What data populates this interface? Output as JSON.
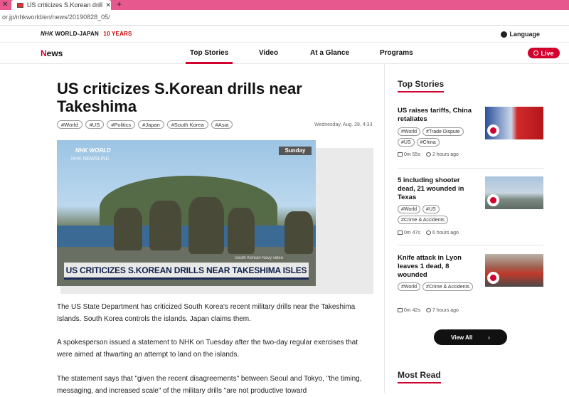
{
  "browser": {
    "tab_title": "US criticizes S.Korean drills nea",
    "url": "or.jp/nhkworld/en/news/20190828_05/"
  },
  "header": {
    "brand_nhk": "NHK",
    "brand_rest": "WORLD-JAPAN",
    "brand_years": "10 YEARS",
    "language": "Language",
    "news_logo_n": "N",
    "news_logo_rest": "ews",
    "nav": [
      "Top Stories",
      "Video",
      "At a Glance",
      "Programs"
    ],
    "live": "Live"
  },
  "article": {
    "headline": "US criticizes S.Korean drills near Takeshima",
    "tags": [
      "#World",
      "#US",
      "#Politics",
      "#Japan",
      "#South Korea",
      "#Asia"
    ],
    "date": "Wednesday, Aug. 28, 4:33",
    "video": {
      "logo": "NHK WORLD",
      "sub": "NHK NEWSLINE",
      "day": "Sunday",
      "caption": "US CRITICIZES S.KOREAN DRILLS NEAR TAKESHIMA ISLES",
      "credit": "South Korean Navy video"
    },
    "paragraphs": [
      "The US State Department has criticized South Korea's recent military drills near the Takeshima Islands. South Korea controls the islands. Japan claims them.",
      "A spokesperson issued a statement to NHK on Tuesday after the two-day regular exercises that were aimed at thwarting an attempt to land on the islands.",
      "The statement says that \"given the recent disagreements\" between Seoul and Tokyo, \"the timing, messaging, and increased scale\" of the military drills \"are not productive toward"
    ]
  },
  "sidebar": {
    "title": "Top Stories",
    "stories": [
      {
        "title": "US raises tariffs, China retaliates",
        "tags": [
          "#World",
          "#Trade Dispute",
          "#US",
          "#China"
        ],
        "duration": "0m 55s",
        "ago": "2 hours ago"
      },
      {
        "title": "5 including shooter dead, 21 wounded in Texas",
        "tags": [
          "#World",
          "#US",
          "#Crime & Accidents"
        ],
        "duration": "0m 47s",
        "ago": "6 hours ago"
      },
      {
        "title": "Knife attack in Lyon leaves 1 dead, 8 wounded",
        "tags": [
          "#World",
          "#Crime & Accidents"
        ],
        "duration": "0m 42s",
        "ago": "7 hours ago"
      }
    ],
    "view_all": "View All",
    "most_read": "Most Read"
  },
  "colors": {
    "accent": "#d2002d",
    "tab_bar": "#e6588e"
  }
}
